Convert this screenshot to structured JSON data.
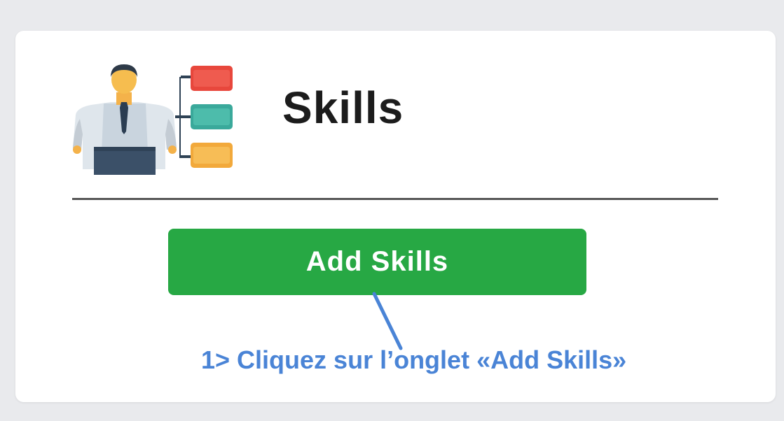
{
  "card": {
    "title": "Skills",
    "icon": "skills-person-list-icon"
  },
  "actions": {
    "add_skills_label": "Add Skills"
  },
  "annotation": {
    "text": "1> Cliquez sur l’onglet «Add Skills»"
  },
  "colors": {
    "button_green": "#27a844",
    "annotation_blue": "#4a84d6",
    "background": "#e9eaed",
    "card": "#ffffff"
  }
}
